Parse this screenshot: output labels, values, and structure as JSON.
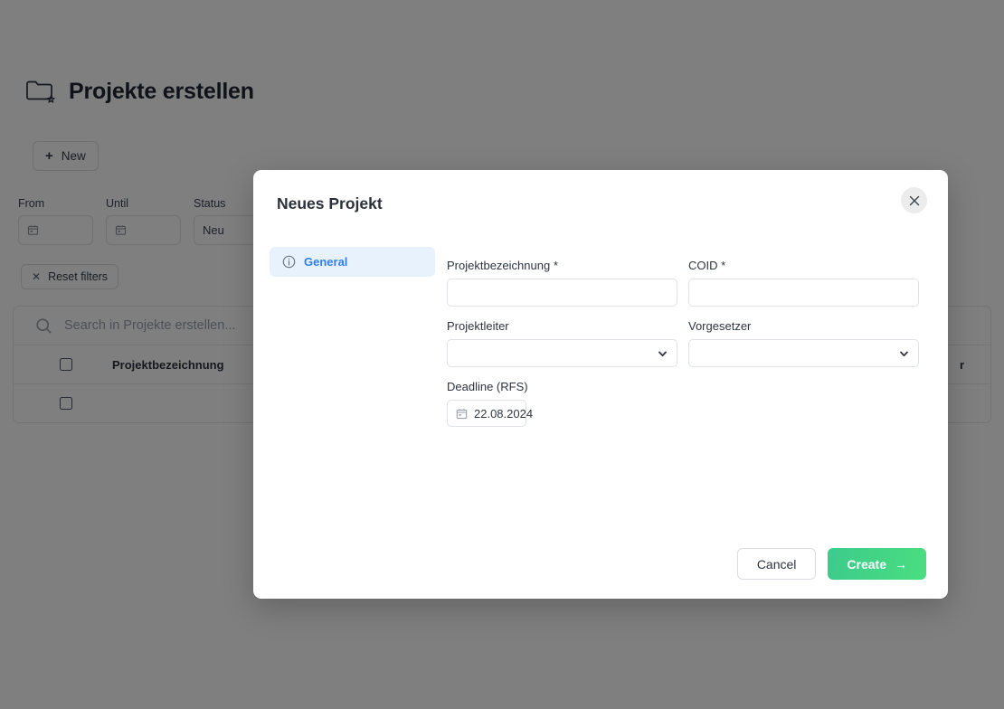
{
  "page": {
    "title": "Projekte erstellen",
    "title_icon": "folder-star-icon",
    "new_button": {
      "label": "New",
      "icon": "plus-icon"
    },
    "filters": [
      {
        "label": "From",
        "value": "",
        "icon": "calendar-icon"
      },
      {
        "label": "Until",
        "value": "",
        "icon": "calendar-icon"
      },
      {
        "label": "Status",
        "value": "Neu",
        "icon": ""
      }
    ],
    "reset_filters": {
      "label": "Reset filters",
      "icon": "close-icon"
    },
    "table": {
      "search_placeholder": "Search in Projekte erstellen...",
      "search_icon": "search-icon",
      "columns": [
        "Projektbezeichnung",
        "r"
      ],
      "rows": [
        {
          "checkbox": "",
          "cells": [
            "",
            ""
          ]
        }
      ]
    }
  },
  "modal": {
    "title": "Neues Projekt",
    "close_icon": "close-icon",
    "nav": [
      {
        "label": "General",
        "icon": "info-circle-icon",
        "active": true
      }
    ],
    "fields": [
      {
        "name": "projektbezeichnung",
        "label": "Projektbezeichnung",
        "required": true,
        "type": "text",
        "value": "",
        "placeholder": ""
      },
      {
        "name": "coid",
        "label": "COID",
        "required": true,
        "type": "text",
        "value": "",
        "placeholder": ""
      },
      {
        "name": "projektleiter",
        "label": "Projektleiter",
        "required": false,
        "type": "select",
        "value": "",
        "icon": "chevron-down-icon"
      },
      {
        "name": "vorgesetzer",
        "label": "Vorgesetzer",
        "required": false,
        "type": "select",
        "value": "",
        "icon": "chevron-down-icon"
      },
      {
        "name": "deadline_rfs",
        "label": "Deadline (RFS)",
        "required": false,
        "type": "date",
        "value": "22.08.2024",
        "icon": "calendar-icon"
      }
    ],
    "footer": {
      "cancel_label": "Cancel",
      "create_label": "Create",
      "create_arrow": "→"
    }
  },
  "colors": {
    "accent_blue": "#2f80ed",
    "nav_active_bg": "#e8f2fd",
    "create_green_start": "#3ccb8c",
    "create_green_end": "#4ade80",
    "overlay": "rgba(0,0,0,0.5)"
  }
}
